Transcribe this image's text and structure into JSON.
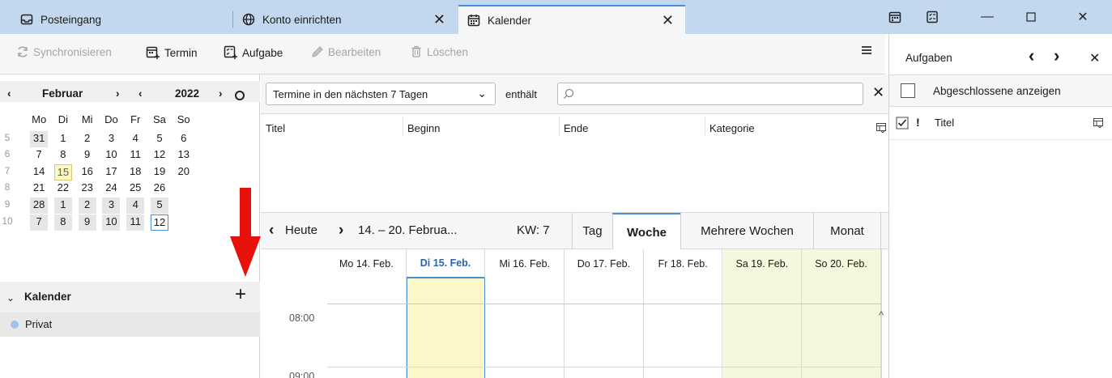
{
  "tabs": [
    {
      "label": "Posteingang",
      "icon": "mail-icon"
    },
    {
      "label": "Konto einrichten",
      "icon": "globe-icon"
    },
    {
      "label": "Kalender",
      "icon": "calendar-icon"
    }
  ],
  "toolbar": {
    "sync": "Synchronisieren",
    "termin": "Termin",
    "aufgabe": "Aufgabe",
    "bearbeiten": "Bearbeiten",
    "loeschen": "Löschen"
  },
  "minical": {
    "month": "Februar",
    "year": "2022",
    "weekdays": [
      "Mo",
      "Di",
      "Mi",
      "Do",
      "Fr",
      "Sa",
      "So"
    ],
    "weeks": [
      {
        "wk": "5",
        "days": [
          "31",
          "1",
          "2",
          "3",
          "4",
          "5",
          "6"
        ]
      },
      {
        "wk": "6",
        "days": [
          "7",
          "8",
          "9",
          "10",
          "11",
          "12",
          "13"
        ]
      },
      {
        "wk": "7",
        "days": [
          "14",
          "15",
          "16",
          "17",
          "18",
          "19",
          "20"
        ]
      },
      {
        "wk": "8",
        "days": [
          "21",
          "22",
          "23",
          "24",
          "25",
          "26",
          ""
        ]
      },
      {
        "wk": "9",
        "days": [
          "28",
          "1",
          "2",
          "3",
          "4",
          "5",
          ""
        ]
      },
      {
        "wk": "10",
        "days": [
          "7",
          "8",
          "9",
          "10",
          "11",
          "12",
          ""
        ]
      }
    ],
    "today": "15"
  },
  "calendars": {
    "header": "Kalender",
    "items": [
      {
        "name": "Privat",
        "color": "#a3c4ea"
      }
    ]
  },
  "filter": {
    "select": "Termine in den nächsten 7 Tagen",
    "contains": "enthält",
    "search_value": ""
  },
  "agenda": {
    "columns": [
      "Titel",
      "Beginn",
      "Ende",
      "Kategorie"
    ]
  },
  "viewbar": {
    "today": "Heute",
    "range": "14. – 20. Februa...",
    "kw": "KW: 7",
    "views": [
      "Tag",
      "Woche",
      "Mehrere Wochen",
      "Monat"
    ],
    "active_view": "Woche"
  },
  "week": {
    "days": [
      "Mo 14. Feb.",
      "Di 15. Feb.",
      "Mi 16. Feb.",
      "Do 17. Feb.",
      "Fr 18. Feb.",
      "Sa 19. Feb.",
      "So 20. Feb."
    ],
    "hours": [
      "08:00",
      "09:00"
    ]
  },
  "tasks": {
    "title": "Aufgaben",
    "show_completed": "Abgeschlossene anzeigen",
    "col_title": "Titel",
    "col_priority": "!"
  },
  "colors": {
    "titlebar": "#c3d8ee",
    "accent": "#4a8fd6",
    "today_bg": "#fdf6c8",
    "weekend_bg": "#f3f9dc",
    "arrow": "#e8100a"
  }
}
